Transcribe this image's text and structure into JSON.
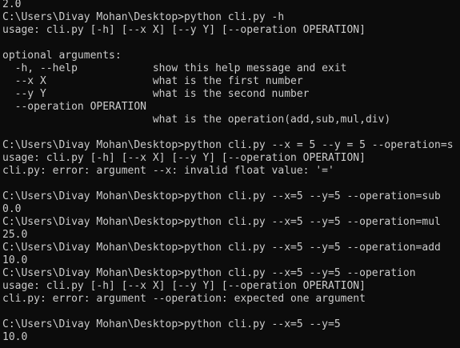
{
  "terminal": {
    "lines": [
      "2.0",
      "C:\\Users\\Divay Mohan\\Desktop>python cli.py -h",
      "usage: cli.py [-h] [--x X] [--y Y] [--operation OPERATION]",
      "",
      "optional arguments:",
      "  -h, --help            show this help message and exit",
      "  --x X                 what is the first number",
      "  --y Y                 what is the second number",
      "  --operation OPERATION",
      "                        what is the operation(add,sub,mul,div)",
      "",
      "C:\\Users\\Divay Mohan\\Desktop>python cli.py --x = 5 --y = 5 --operation=s",
      "usage: cli.py [-h] [--x X] [--y Y] [--operation OPERATION]",
      "cli.py: error: argument --x: invalid float value: '='",
      "",
      "C:\\Users\\Divay Mohan\\Desktop>python cli.py --x=5 --y=5 --operation=sub",
      "0.0",
      "C:\\Users\\Divay Mohan\\Desktop>python cli.py --x=5 --y=5 --operation=mul",
      "25.0",
      "C:\\Users\\Divay Mohan\\Desktop>python cli.py --x=5 --y=5 --operation=add",
      "10.0",
      "C:\\Users\\Divay Mohan\\Desktop>python cli.py --x=5 --y=5 --operation",
      "usage: cli.py [-h] [--x X] [--y Y] [--operation OPERATION]",
      "cli.py: error: argument --operation: expected one argument",
      "",
      "C:\\Users\\Divay Mohan\\Desktop>python cli.py --x=5 --y=5",
      "10.0"
    ]
  },
  "colors": {
    "background": "#0c0c0c",
    "text": "#cccccc"
  }
}
